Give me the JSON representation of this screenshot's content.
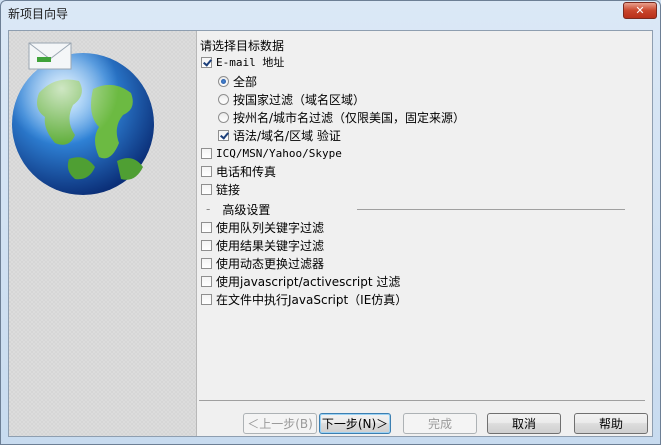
{
  "window": {
    "title": "新项目向导",
    "close_glyph": "✕"
  },
  "main": {
    "heading": "请选择目标数据",
    "email": {
      "label": "E-mail 地址",
      "checked": true
    },
    "email_options": [
      {
        "label": "全部",
        "type": "radio",
        "checked": true
      },
      {
        "label": "按国家过滤（域名区域）",
        "type": "radio",
        "checked": false
      },
      {
        "label": "按州名/城市名过滤（仅限美国，固定来源）",
        "type": "radio",
        "checked": false
      },
      {
        "label": "语法/域名/区域 验证",
        "type": "checkbox",
        "checked": true
      }
    ],
    "targets": [
      {
        "label": "ICQ/MSN/Yahoo/Skype",
        "checked": false
      },
      {
        "label": "电话和传真",
        "checked": false
      },
      {
        "label": "链接",
        "checked": false
      }
    ],
    "advanced": {
      "title": "高级设置",
      "collapse_glyph": "-",
      "options": [
        {
          "label": "使用队列关键字过滤",
          "checked": false
        },
        {
          "label": "使用结果关键字过滤",
          "checked": false
        },
        {
          "label": "使用动态更换过滤器",
          "checked": false
        },
        {
          "label": "使用javascript/activescript 过滤",
          "checked": false
        },
        {
          "label": "在文件中执行JavaScript（IE仿真）",
          "checked": false
        }
      ]
    }
  },
  "buttons": {
    "back": "＜上一步(B)",
    "next": "下一步(N)＞",
    "finish": "完成",
    "cancel": "取消",
    "help": "帮助"
  }
}
